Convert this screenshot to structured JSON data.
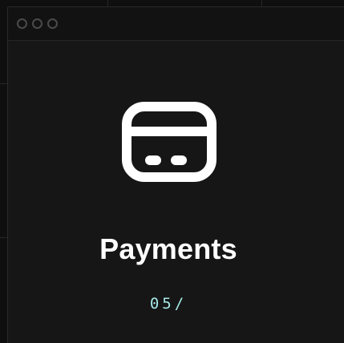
{
  "window": {
    "controls": [
      "close",
      "minimize",
      "maximize"
    ]
  },
  "card": {
    "icon": "credit-card-icon",
    "title": "Payments",
    "index": "05/"
  },
  "colors": {
    "background": "#0f0f0f",
    "panel": "#161616",
    "title": "#ffffff",
    "index": "#a6e8e6"
  }
}
